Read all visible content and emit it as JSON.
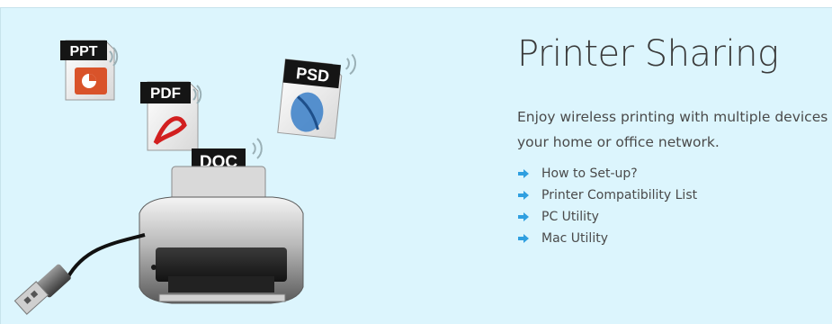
{
  "hero": {
    "title": "Printer Sharing",
    "description": "Enjoy wireless printing with multiple devices in your home or office network.",
    "links": [
      {
        "label": "How to Set-up?",
        "icon": "arrow-right-icon"
      },
      {
        "label": "Printer Compatibility List",
        "icon": "arrow-right-icon"
      },
      {
        "label": "PC Utility",
        "icon": "arrow-right-icon"
      },
      {
        "label": "Mac Utility",
        "icon": "arrow-right-icon"
      }
    ]
  },
  "illustration": {
    "files": [
      {
        "label": "PPT",
        "icon": "ppt-file-icon"
      },
      {
        "label": "PDF",
        "icon": "pdf-file-icon"
      },
      {
        "label": "PSD",
        "icon": "psd-file-icon"
      },
      {
        "label": "DOC",
        "icon": "doc-file-icon"
      }
    ],
    "device": "printer-icon",
    "cable": "usb-cable-icon"
  },
  "colors": {
    "background": "#dcf5fd",
    "link_arrow": "#2f9fe0",
    "title_text": "#3a3a3a",
    "body_text": "#4a4a4a"
  }
}
